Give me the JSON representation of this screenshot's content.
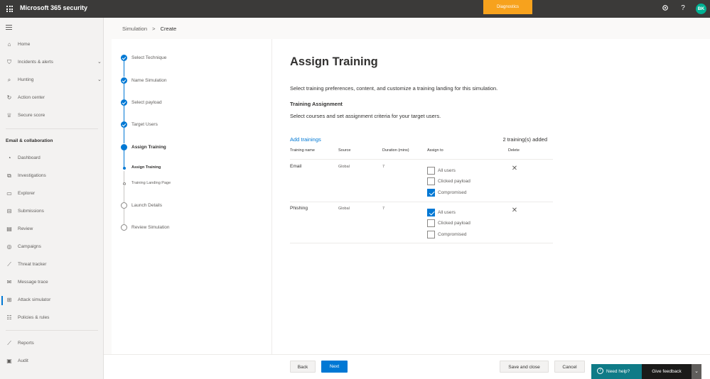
{
  "topbar": {
    "app_title": "Microsoft 365 security",
    "diagnostics_label": "Diagnostics",
    "settings_icon": "gear-icon",
    "help_label": "?",
    "avatar_initials": "BK"
  },
  "nav": {
    "items": [
      {
        "label": "Home",
        "icon": "home-icon"
      },
      {
        "label": "Incidents & alerts",
        "icon": "shield-icon"
      },
      {
        "label": "Hunting",
        "icon": "hunting-icon"
      },
      {
        "label": "Action center",
        "icon": "action-center-icon"
      },
      {
        "label": "Secure score",
        "icon": "trophy-icon"
      },
      {
        "label": "Dashboard",
        "icon": "dashboard-icon"
      },
      {
        "label": "Investigations",
        "icon": "investigations-icon"
      },
      {
        "label": "Explorer",
        "icon": "explorer-icon"
      },
      {
        "label": "Submissions",
        "icon": "submissions-icon"
      },
      {
        "label": "Review",
        "icon": "review-icon"
      },
      {
        "label": "Campaigns",
        "icon": "campaigns-icon"
      },
      {
        "label": "Threat tracker",
        "icon": "threat-tracker-icon"
      },
      {
        "label": "Message trace",
        "icon": "message-trace-icon"
      },
      {
        "label": "Attack simulator",
        "icon": "attack-simulator-icon"
      },
      {
        "label": "Policies & rules",
        "icon": "policies-icon"
      },
      {
        "label": "Reports",
        "icon": "reports-icon"
      },
      {
        "label": "Audit",
        "icon": "audit-icon"
      }
    ],
    "section_email": "Email & collaboration"
  },
  "breadcrumb": {
    "parent": "Simulation",
    "separator": ">",
    "current": "Create"
  },
  "steps": {
    "select_technique": "Select Technique",
    "name_simulation": "Name Simulation",
    "select_payload": "Select payload",
    "target_users": "Target Users",
    "assign_training": "Assign Training",
    "sub_assign_training": "Assign Training",
    "sub_training_landing": "Training Landing Page",
    "launch_details": "Launch Details",
    "review_simulation": "Review Simulation"
  },
  "main": {
    "title": "Assign Training",
    "description": "Select training preferences, content, and customize a training landing for this simulation.",
    "section_title": "Training Assignment",
    "section_desc": "Select courses and set assignment criteria for your target users.",
    "add_trainings": "Add trainings",
    "count": "2 training(s) added",
    "columns": {
      "name": "Training name",
      "source": "Source",
      "duration": "Duration (mins)",
      "assign": "Assign to",
      "delete": "Delete"
    },
    "rows": [
      {
        "name": "Email",
        "source": "Global",
        "duration": "7",
        "options": [
          {
            "label": "All users",
            "checked": false
          },
          {
            "label": "Clicked payload",
            "checked": false
          },
          {
            "label": "Compromised",
            "checked": true
          }
        ]
      },
      {
        "name": "Phishing",
        "source": "Global",
        "duration": "7",
        "options": [
          {
            "label": "All users",
            "checked": true
          },
          {
            "label": "Clicked payload",
            "checked": false
          },
          {
            "label": "Compromised",
            "checked": false
          }
        ]
      }
    ]
  },
  "footer": {
    "back": "Back",
    "next": "Next",
    "save_close": "Save and close",
    "cancel": "Cancel",
    "need_help": "Need help?",
    "give_feedback": "Give feedback"
  },
  "colors": {
    "accent": "#0078d4",
    "topbar": "#3b3a39",
    "diagnostics": "#f7a21d",
    "avatar": "#00b294",
    "help": "#0f7b87"
  }
}
